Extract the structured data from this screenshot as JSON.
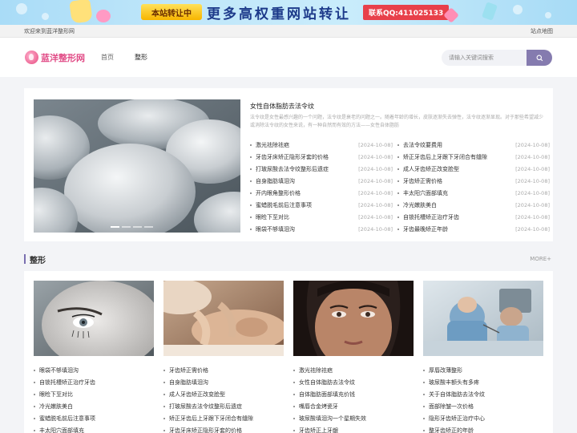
{
  "banner": {
    "tag": "本站转让中",
    "headline": "更多高权重网站转让",
    "qq": "联系QQ:411025133"
  },
  "topbar": {
    "welcome": "欢迎来到蓝洋整形网",
    "sitemap": "站点地图"
  },
  "header": {
    "logo_text": "蓝洋整形网",
    "nav": [
      {
        "label": "首页"
      },
      {
        "label": "整形"
      }
    ],
    "search_placeholder": "请输入关键词搜索"
  },
  "featured": {
    "title": "女性自体脂肪去法令纹",
    "description": "法令纹是女性最感兴趣的一个问题，法令纹是衰老的问题之一。随着年龄的增长，皮肤逐渐失去弹性，法令纹逐渐显现。对于那些希望减少或消除法令纹的女性来说，有一种自然而有效的方法——女性自体脂肪",
    "list": [
      {
        "title": "激光祛除祛疤",
        "date": "[2024-10-08]"
      },
      {
        "title": "去法令纹要费用",
        "date": "[2024-10-08]"
      },
      {
        "title": "牙齿牙床矫正隐形牙套的价格",
        "date": "[2024-10-08]"
      },
      {
        "title": "矫正牙齿后上牙跟下牙闭合有缝隙",
        "date": "[2024-10-08]"
      },
      {
        "title": "打玻尿酸去法令纹整形后遗症",
        "date": "[2024-10-08]"
      },
      {
        "title": "成人牙齿矫正改变脸型",
        "date": "[2024-10-08]"
      },
      {
        "title": "自身脂肪填泪沟",
        "date": "[2024-10-08]"
      },
      {
        "title": "牙齿矫正需价格",
        "date": "[2024-10-08]"
      },
      {
        "title": "开内眼角整形价格",
        "date": "[2024-10-08]"
      },
      {
        "title": "丰太阳穴面部填充",
        "date": "[2024-10-08]"
      },
      {
        "title": "蜜蜡脱毛前后注意事项",
        "date": "[2024-10-08]"
      },
      {
        "title": "冷光嫩肤美白",
        "date": "[2024-10-08]"
      },
      {
        "title": "眼睑下至对比",
        "date": "[2024-10-08]"
      },
      {
        "title": "自锁托槽矫正治疗牙齿",
        "date": "[2024-10-08]"
      },
      {
        "title": "眼袋不够填泪沟",
        "date": "[2024-10-08]"
      },
      {
        "title": "牙齿最晚矫正年龄",
        "date": "[2024-10-08]"
      }
    ]
  },
  "section": {
    "title": "整形",
    "more": "MORE+"
  },
  "cards": [
    {
      "items": [
        "眼袋不够填泪沟",
        "自锁托槽矫正治疗牙齿",
        "眼睑下至对比",
        "冷光嫩肤美白",
        "蜜蜡脱毛前后注意事项",
        "丰太阳穴面部填充"
      ]
    },
    {
      "items": [
        "牙齿矫正需价格",
        "自身脂肪填泪沟",
        "成人牙齿矫正改变脸型",
        "打玻尿酸去法令纹整形后遗症",
        "矫正牙齿后上牙跟下牙闭合有缝隙",
        "牙齿牙床矫正隐形牙套的价格"
      ]
    },
    {
      "items": [
        "激光祛除祛疤",
        "女性自体脂肪去法令纹",
        "自体脂肪面部填充价钱",
        "嘴唇合金烤瓷牙",
        "玻尿酸填泪沟一个星期失效",
        "牙齿矫正上牙龈"
      ]
    },
    {
      "items": [
        "厚唇改薄整形",
        "玻尿酸丰额头有多疼",
        "关于自体脂肪去法令纹",
        "面部除皱一次价格",
        "隐形牙齿矫正治疗中心",
        "整牙齿矫正的年龄"
      ]
    }
  ]
}
